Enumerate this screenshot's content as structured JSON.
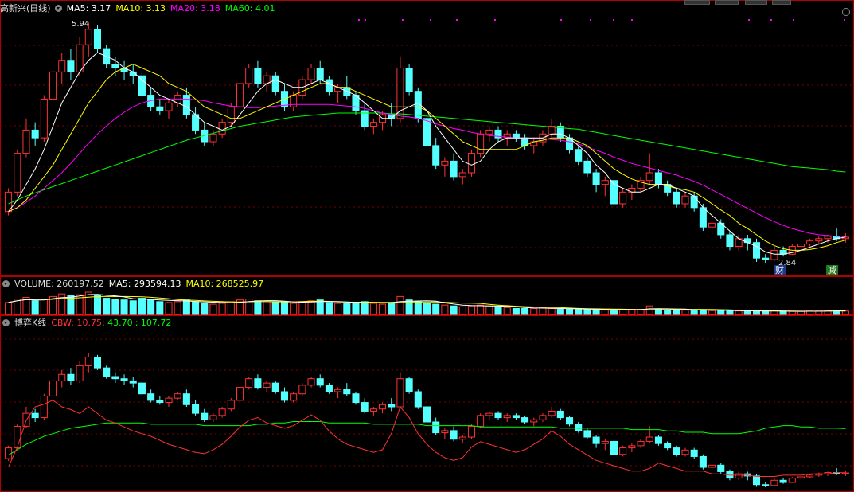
{
  "colors": {
    "up": "#ff3232",
    "down": "#54ffff",
    "ma5": "#ffffff",
    "ma10": "#ffff00",
    "ma20": "#ff00ff",
    "ma60": "#00ff00",
    "vma5": "#ffffff",
    "vma10": "#ffff00",
    "cbw1": "#ff3232",
    "cbw2": "#00ff00",
    "grid": "#7a0000",
    "border": "#b00000"
  },
  "main": {
    "stock": "高新兴(日线)",
    "ma5": "MA5: 3.17",
    "ma10": "MA10: 3.13",
    "ma20": "MA20: 3.18",
    "ma60": "MA60: 4.01",
    "high_label": "5.94",
    "low_label": "2.84",
    "badge_cai": "财",
    "badge_jian": "减"
  },
  "volume": {
    "title": "VOLUME: 260197.52",
    "ma5": "MA5: 293594.13",
    "ma10": "MA10: 268525.97"
  },
  "cbw": {
    "title": "博弈K线",
    "name": "CBW: 10.75",
    "v2": ": 43.70",
    "v3": ": 107.72"
  },
  "chart_data": {
    "type": "candlestick",
    "price_range": [
      2.84,
      5.94
    ],
    "candles_ohlc": [
      [
        3.5,
        3.8,
        3.45,
        3.75
      ],
      [
        3.75,
        4.3,
        3.7,
        4.25
      ],
      [
        4.25,
        4.7,
        4.2,
        4.55
      ],
      [
        4.55,
        4.65,
        4.35,
        4.45
      ],
      [
        4.45,
        5.0,
        4.4,
        4.95
      ],
      [
        4.95,
        5.4,
        4.9,
        5.3
      ],
      [
        5.3,
        5.55,
        5.15,
        5.45
      ],
      [
        5.45,
        5.6,
        5.2,
        5.3
      ],
      [
        5.3,
        5.75,
        5.25,
        5.65
      ],
      [
        5.65,
        5.94,
        5.5,
        5.85
      ],
      [
        5.85,
        5.9,
        5.55,
        5.6
      ],
      [
        5.6,
        5.65,
        5.35,
        5.4
      ],
      [
        5.4,
        5.5,
        5.25,
        5.35
      ],
      [
        5.35,
        5.45,
        5.2,
        5.3
      ],
      [
        5.3,
        5.4,
        5.15,
        5.25
      ],
      [
        5.25,
        5.3,
        4.95,
        5.0
      ],
      [
        5.0,
        5.1,
        4.8,
        4.85
      ],
      [
        4.85,
        4.95,
        4.75,
        4.8
      ],
      [
        4.8,
        4.95,
        4.7,
        4.9
      ],
      [
        4.9,
        5.05,
        4.85,
        5.0
      ],
      [
        5.0,
        5.1,
        4.7,
        4.75
      ],
      [
        4.75,
        4.85,
        4.5,
        4.55
      ],
      [
        4.55,
        4.65,
        4.35,
        4.4
      ],
      [
        4.4,
        4.55,
        4.35,
        4.5
      ],
      [
        4.5,
        4.7,
        4.45,
        4.65
      ],
      [
        4.65,
        4.9,
        4.6,
        4.85
      ],
      [
        4.85,
        5.2,
        4.8,
        5.15
      ],
      [
        5.15,
        5.4,
        5.1,
        5.35
      ],
      [
        5.35,
        5.45,
        5.1,
        5.15
      ],
      [
        5.15,
        5.3,
        5.05,
        5.25
      ],
      [
        5.25,
        5.3,
        5.0,
        5.05
      ],
      [
        5.05,
        5.15,
        4.8,
        4.85
      ],
      [
        4.85,
        5.05,
        4.8,
        5.0
      ],
      [
        5.0,
        5.25,
        4.95,
        5.2
      ],
      [
        5.2,
        5.4,
        5.15,
        5.35
      ],
      [
        5.35,
        5.45,
        5.15,
        5.2
      ],
      [
        5.2,
        5.25,
        5.0,
        5.05
      ],
      [
        5.05,
        5.15,
        4.9,
        5.1
      ],
      [
        5.1,
        5.25,
        4.95,
        5.0
      ],
      [
        5.0,
        5.05,
        4.75,
        4.8
      ],
      [
        4.8,
        4.9,
        4.55,
        4.6
      ],
      [
        4.6,
        4.7,
        4.5,
        4.65
      ],
      [
        4.65,
        4.8,
        4.55,
        4.75
      ],
      [
        4.75,
        4.9,
        4.6,
        4.7
      ],
      [
        4.7,
        5.5,
        4.65,
        5.35
      ],
      [
        5.35,
        5.4,
        5.0,
        5.05
      ],
      [
        5.05,
        5.1,
        4.65,
        4.7
      ],
      [
        4.7,
        4.75,
        4.3,
        4.35
      ],
      [
        4.35,
        4.45,
        4.05,
        4.1
      ],
      [
        4.1,
        4.2,
        3.95,
        4.15
      ],
      [
        4.15,
        4.25,
        3.9,
        3.95
      ],
      [
        3.95,
        4.05,
        3.85,
        4.0
      ],
      [
        4.0,
        4.3,
        3.95,
        4.25
      ],
      [
        4.25,
        4.55,
        4.2,
        4.5
      ],
      [
        4.5,
        4.6,
        4.4,
        4.55
      ],
      [
        4.55,
        4.6,
        4.4,
        4.45
      ],
      [
        4.45,
        4.55,
        4.35,
        4.5
      ],
      [
        4.5,
        4.55,
        4.4,
        4.45
      ],
      [
        4.45,
        4.5,
        4.3,
        4.35
      ],
      [
        4.35,
        4.45,
        4.25,
        4.4
      ],
      [
        4.4,
        4.55,
        4.35,
        4.5
      ],
      [
        4.5,
        4.7,
        4.45,
        4.6
      ],
      [
        4.6,
        4.65,
        4.4,
        4.45
      ],
      [
        4.45,
        4.5,
        4.25,
        4.3
      ],
      [
        4.3,
        4.35,
        4.1,
        4.15
      ],
      [
        4.15,
        4.2,
        3.95,
        4.0
      ],
      [
        4.0,
        4.05,
        3.75,
        3.85
      ],
      [
        3.85,
        3.95,
        3.7,
        3.9
      ],
      [
        3.9,
        3.95,
        3.55,
        3.6
      ],
      [
        3.6,
        3.8,
        3.55,
        3.75
      ],
      [
        3.75,
        3.85,
        3.65,
        3.8
      ],
      [
        3.8,
        3.95,
        3.75,
        3.9
      ],
      [
        3.9,
        4.25,
        3.85,
        4.0
      ],
      [
        4.0,
        4.05,
        3.8,
        3.85
      ],
      [
        3.85,
        3.9,
        3.7,
        3.75
      ],
      [
        3.75,
        3.8,
        3.55,
        3.6
      ],
      [
        3.6,
        3.75,
        3.55,
        3.7
      ],
      [
        3.7,
        3.75,
        3.5,
        3.55
      ],
      [
        3.55,
        3.6,
        3.25,
        3.3
      ],
      [
        3.3,
        3.4,
        3.2,
        3.35
      ],
      [
        3.35,
        3.4,
        3.15,
        3.2
      ],
      [
        3.2,
        3.25,
        3.0,
        3.05
      ],
      [
        3.05,
        3.2,
        3.0,
        3.15
      ],
      [
        3.15,
        3.2,
        3.0,
        3.1
      ],
      [
        3.1,
        3.15,
        2.85,
        2.9
      ],
      [
        2.9,
        2.95,
        2.84,
        2.88
      ],
      [
        2.88,
        3.05,
        2.86,
        3.0
      ],
      [
        3.0,
        3.05,
        2.92,
        2.95
      ],
      [
        2.95,
        3.08,
        2.94,
        3.05
      ],
      [
        3.05,
        3.1,
        3.0,
        3.08
      ],
      [
        3.08,
        3.15,
        3.05,
        3.12
      ],
      [
        3.12,
        3.18,
        3.08,
        3.15
      ],
      [
        3.15,
        3.2,
        3.1,
        3.18
      ],
      [
        3.18,
        3.28,
        3.12,
        3.15
      ],
      [
        3.15,
        3.22,
        3.1,
        3.17
      ]
    ],
    "ma5": [
      3.5,
      3.65,
      3.85,
      4.05,
      4.3,
      4.6,
      4.9,
      5.1,
      5.3,
      5.45,
      5.55,
      5.5,
      5.45,
      5.35,
      5.3,
      5.2,
      5.1,
      5.0,
      4.95,
      4.9,
      4.85,
      4.75,
      4.65,
      4.6,
      4.55,
      4.6,
      4.75,
      4.9,
      5.05,
      5.15,
      5.2,
      5.15,
      5.1,
      5.1,
      5.15,
      5.2,
      5.15,
      5.1,
      5.05,
      5.0,
      4.9,
      4.8,
      4.7,
      4.7,
      4.8,
      4.85,
      4.9,
      4.8,
      4.6,
      4.45,
      4.3,
      4.15,
      4.1,
      4.15,
      4.3,
      4.4,
      4.45,
      4.45,
      4.45,
      4.45,
      4.45,
      4.5,
      4.5,
      4.45,
      4.35,
      4.25,
      4.1,
      4.0,
      3.85,
      3.8,
      3.75,
      3.75,
      3.8,
      3.85,
      3.85,
      3.8,
      3.75,
      3.7,
      3.55,
      3.45,
      3.35,
      3.25,
      3.15,
      3.1,
      3.05,
      2.98,
      2.95,
      2.95,
      2.97,
      3.0,
      3.04,
      3.08,
      3.12,
      3.15,
      3.17
    ],
    "ma10": [
      3.5,
      3.55,
      3.65,
      3.8,
      3.95,
      4.1,
      4.3,
      4.5,
      4.7,
      4.9,
      5.05,
      5.2,
      5.3,
      5.35,
      5.4,
      5.35,
      5.3,
      5.25,
      5.15,
      5.1,
      5.05,
      4.95,
      4.85,
      4.8,
      4.75,
      4.7,
      4.7,
      4.75,
      4.8,
      4.85,
      4.9,
      4.95,
      5.0,
      5.05,
      5.1,
      5.15,
      5.15,
      5.1,
      5.1,
      5.05,
      5.0,
      4.95,
      4.9,
      4.85,
      4.85,
      4.85,
      4.85,
      4.8,
      4.7,
      4.6,
      4.5,
      4.4,
      4.35,
      4.3,
      4.3,
      4.3,
      4.3,
      4.3,
      4.35,
      4.4,
      4.42,
      4.45,
      4.45,
      4.45,
      4.4,
      4.35,
      4.25,
      4.15,
      4.05,
      3.98,
      3.92,
      3.88,
      3.85,
      3.85,
      3.83,
      3.8,
      3.78,
      3.75,
      3.68,
      3.6,
      3.52,
      3.45,
      3.35,
      3.28,
      3.2,
      3.12,
      3.06,
      3.02,
      3.0,
      3.0,
      3.01,
      3.03,
      3.06,
      3.1,
      3.13
    ],
    "ma20": [
      3.5,
      3.55,
      3.62,
      3.7,
      3.8,
      3.9,
      4.0,
      4.12,
      4.25,
      4.38,
      4.5,
      4.6,
      4.7,
      4.78,
      4.85,
      4.9,
      4.93,
      4.95,
      4.95,
      4.95,
      4.95,
      4.94,
      4.93,
      4.9,
      4.88,
      4.86,
      4.85,
      4.84,
      4.84,
      4.85,
      4.86,
      4.87,
      4.88,
      4.88,
      4.88,
      4.88,
      4.88,
      4.87,
      4.86,
      4.85,
      4.83,
      4.8,
      4.77,
      4.75,
      4.73,
      4.72,
      4.7,
      4.67,
      4.63,
      4.6,
      4.57,
      4.55,
      4.52,
      4.5,
      4.48,
      4.47,
      4.46,
      4.45,
      4.45,
      4.44,
      4.44,
      4.43,
      4.42,
      4.4,
      4.37,
      4.33,
      4.29,
      4.25,
      4.2,
      4.16,
      4.12,
      4.09,
      4.06,
      4.03,
      4.0,
      3.97,
      3.93,
      3.89,
      3.84,
      3.78,
      3.72,
      3.66,
      3.6,
      3.54,
      3.48,
      3.42,
      3.37,
      3.32,
      3.28,
      3.25,
      3.22,
      3.2,
      3.19,
      3.18,
      3.18
    ],
    "ma60": [
      3.6,
      3.65,
      3.7,
      3.74,
      3.78,
      3.82,
      3.86,
      3.9,
      3.94,
      3.98,
      4.02,
      4.06,
      4.1,
      4.14,
      4.18,
      4.22,
      4.26,
      4.3,
      4.34,
      4.38,
      4.42,
      4.45,
      4.48,
      4.51,
      4.54,
      4.57,
      4.6,
      4.62,
      4.64,
      4.66,
      4.68,
      4.7,
      4.72,
      4.73,
      4.74,
      4.75,
      4.76,
      4.77,
      4.77,
      4.77,
      4.77,
      4.77,
      4.77,
      4.76,
      4.76,
      4.75,
      4.74,
      4.73,
      4.72,
      4.71,
      4.7,
      4.69,
      4.68,
      4.67,
      4.66,
      4.65,
      4.64,
      4.63,
      4.62,
      4.61,
      4.6,
      4.59,
      4.58,
      4.57,
      4.56,
      4.54,
      4.52,
      4.5,
      4.48,
      4.46,
      4.44,
      4.42,
      4.4,
      4.38,
      4.36,
      4.34,
      4.32,
      4.3,
      4.28,
      4.26,
      4.24,
      4.22,
      4.2,
      4.18,
      4.16,
      4.14,
      4.12,
      4.1,
      4.08,
      4.07,
      4.06,
      4.05,
      4.04,
      4.02,
      4.01
    ],
    "volume": [
      28,
      36,
      40,
      32,
      35,
      42,
      48,
      44,
      46,
      52,
      45,
      38,
      36,
      34,
      32,
      38,
      36,
      30,
      28,
      30,
      34,
      30,
      26,
      24,
      26,
      30,
      34,
      36,
      32,
      30,
      30,
      28,
      26,
      30,
      32,
      34,
      28,
      26,
      26,
      28,
      30,
      26,
      24,
      28,
      42,
      34,
      30,
      26,
      24,
      22,
      20,
      18,
      20,
      22,
      20,
      18,
      16,
      14,
      14,
      14,
      16,
      14,
      12,
      12,
      12,
      12,
      12,
      10,
      10,
      12,
      12,
      12,
      20,
      12,
      10,
      10,
      10,
      10,
      10,
      9,
      9,
      8,
      8,
      8,
      8,
      7,
      8,
      7,
      7,
      7,
      8,
      8,
      9,
      10,
      8
    ],
    "cbw_range": [
      0,
      120
    ],
    "cbw_line1": [
      15,
      30,
      50,
      60,
      62,
      65,
      60,
      58,
      55,
      60,
      55,
      50,
      48,
      45,
      42,
      40,
      38,
      35,
      32,
      30,
      28,
      26,
      25,
      28,
      32,
      38,
      45,
      50,
      52,
      48,
      46,
      44,
      46,
      50,
      54,
      50,
      42,
      36,
      32,
      30,
      28,
      26,
      28,
      40,
      60,
      52,
      40,
      32,
      26,
      22,
      20,
      22,
      30,
      34,
      32,
      30,
      28,
      26,
      28,
      32,
      36,
      42,
      38,
      32,
      28,
      24,
      20,
      18,
      16,
      14,
      12,
      12,
      14,
      18,
      16,
      14,
      12,
      12,
      12,
      10,
      10,
      9,
      9,
      9,
      8,
      8,
      8,
      9,
      9,
      9,
      10,
      10,
      10,
      11,
      10.75
    ],
    "cbw_line2": [
      24,
      28,
      32,
      35,
      38,
      40,
      42,
      44,
      45,
      46,
      47,
      48,
      48,
      48,
      48,
      48,
      47,
      47,
      47,
      47,
      47,
      47,
      46,
      46,
      46,
      46,
      46,
      46,
      47,
      47,
      48,
      48,
      49,
      49,
      49,
      49,
      48,
      48,
      48,
      48,
      48,
      47,
      47,
      47,
      47,
      47,
      47,
      46,
      46,
      46,
      46,
      46,
      46,
      45,
      45,
      45,
      45,
      45,
      45,
      45,
      45,
      45,
      44,
      44,
      44,
      44,
      44,
      44,
      44,
      44,
      43,
      43,
      43,
      43,
      42,
      42,
      41,
      41,
      41,
      40,
      40,
      40,
      40,
      41,
      42,
      44,
      45,
      46,
      46,
      45,
      45,
      44,
      44,
      44,
      43.7
    ]
  }
}
